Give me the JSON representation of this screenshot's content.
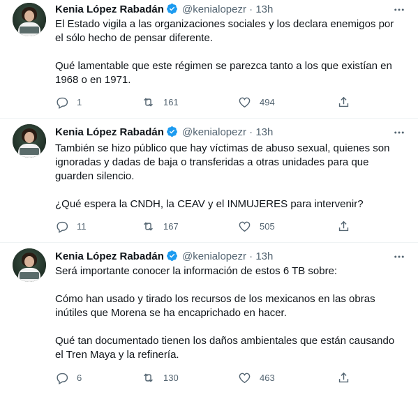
{
  "author": {
    "name": "Kenia López Rabadán",
    "handle": "@kenialopezr",
    "dot": "·"
  },
  "tweets": [
    {
      "time": "13h",
      "paragraphs": [
        "El Estado vigila a las organizaciones sociales y los declara enemigos por el sólo hecho de pensar diferente.",
        "Qué lamentable que este régimen se parezca tanto a los que existían en 1968 o en 1971."
      ],
      "replies": "1",
      "retweets": "161",
      "likes": "494"
    },
    {
      "time": "13h",
      "paragraphs": [
        "También se hizo público que hay víctimas de abuso sexual, quienes son ignoradas y dadas de baja o transferidas a otras unidades para que guarden silencio.",
        "¿Qué espera la CNDH, la CEAV y el INMUJERES para intervenir?"
      ],
      "replies": "11",
      "retweets": "167",
      "likes": "505"
    },
    {
      "time": "13h",
      "paragraphs": [
        "Será importante conocer la información de estos 6 TB sobre:",
        "Cómo han usado y tirado los recursos de los mexicanos en las obras inútiles que Morena se ha encaprichado en hacer.",
        "Qué tan documentado tienen los daños ambientales que están causando el Tren Maya y la refinería."
      ],
      "replies": "6",
      "retweets": "130",
      "likes": "463"
    }
  ],
  "colors": {
    "accent": "#1d9bf0",
    "secondary": "#536471",
    "text": "#0f1419"
  }
}
